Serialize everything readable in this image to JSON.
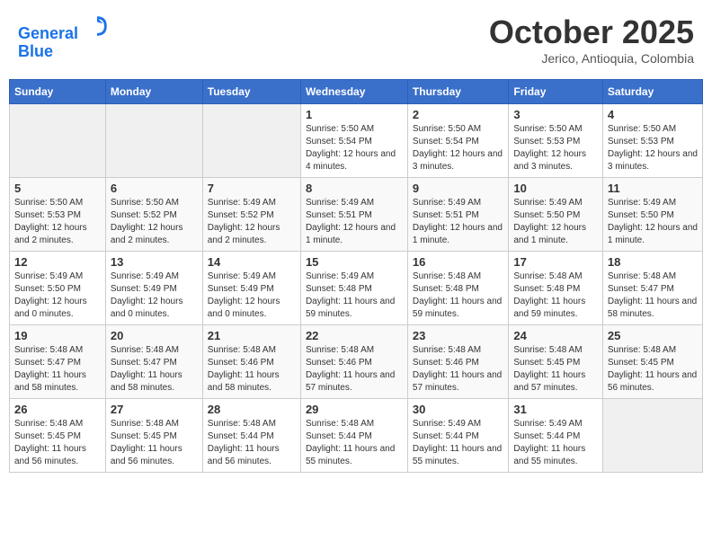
{
  "header": {
    "logo_line1": "General",
    "logo_line2": "Blue",
    "month_title": "October 2025",
    "subtitle": "Jerico, Antioquia, Colombia"
  },
  "weekdays": [
    "Sunday",
    "Monday",
    "Tuesday",
    "Wednesday",
    "Thursday",
    "Friday",
    "Saturday"
  ],
  "weeks": [
    [
      {
        "day": "",
        "empty": true
      },
      {
        "day": "",
        "empty": true
      },
      {
        "day": "",
        "empty": true
      },
      {
        "day": "1",
        "sunrise": "5:50 AM",
        "sunset": "5:54 PM",
        "daylight": "12 hours and 4 minutes."
      },
      {
        "day": "2",
        "sunrise": "5:50 AM",
        "sunset": "5:54 PM",
        "daylight": "12 hours and 3 minutes."
      },
      {
        "day": "3",
        "sunrise": "5:50 AM",
        "sunset": "5:53 PM",
        "daylight": "12 hours and 3 minutes."
      },
      {
        "day": "4",
        "sunrise": "5:50 AM",
        "sunset": "5:53 PM",
        "daylight": "12 hours and 3 minutes."
      }
    ],
    [
      {
        "day": "5",
        "sunrise": "5:50 AM",
        "sunset": "5:53 PM",
        "daylight": "12 hours and 2 minutes."
      },
      {
        "day": "6",
        "sunrise": "5:50 AM",
        "sunset": "5:52 PM",
        "daylight": "12 hours and 2 minutes."
      },
      {
        "day": "7",
        "sunrise": "5:49 AM",
        "sunset": "5:52 PM",
        "daylight": "12 hours and 2 minutes."
      },
      {
        "day": "8",
        "sunrise": "5:49 AM",
        "sunset": "5:51 PM",
        "daylight": "12 hours and 1 minute."
      },
      {
        "day": "9",
        "sunrise": "5:49 AM",
        "sunset": "5:51 PM",
        "daylight": "12 hours and 1 minute."
      },
      {
        "day": "10",
        "sunrise": "5:49 AM",
        "sunset": "5:50 PM",
        "daylight": "12 hours and 1 minute."
      },
      {
        "day": "11",
        "sunrise": "5:49 AM",
        "sunset": "5:50 PM",
        "daylight": "12 hours and 1 minute."
      }
    ],
    [
      {
        "day": "12",
        "sunrise": "5:49 AM",
        "sunset": "5:50 PM",
        "daylight": "12 hours and 0 minutes."
      },
      {
        "day": "13",
        "sunrise": "5:49 AM",
        "sunset": "5:49 PM",
        "daylight": "12 hours and 0 minutes."
      },
      {
        "day": "14",
        "sunrise": "5:49 AM",
        "sunset": "5:49 PM",
        "daylight": "12 hours and 0 minutes."
      },
      {
        "day": "15",
        "sunrise": "5:49 AM",
        "sunset": "5:48 PM",
        "daylight": "11 hours and 59 minutes."
      },
      {
        "day": "16",
        "sunrise": "5:48 AM",
        "sunset": "5:48 PM",
        "daylight": "11 hours and 59 minutes."
      },
      {
        "day": "17",
        "sunrise": "5:48 AM",
        "sunset": "5:48 PM",
        "daylight": "11 hours and 59 minutes."
      },
      {
        "day": "18",
        "sunrise": "5:48 AM",
        "sunset": "5:47 PM",
        "daylight": "11 hours and 58 minutes."
      }
    ],
    [
      {
        "day": "19",
        "sunrise": "5:48 AM",
        "sunset": "5:47 PM",
        "daylight": "11 hours and 58 minutes."
      },
      {
        "day": "20",
        "sunrise": "5:48 AM",
        "sunset": "5:47 PM",
        "daylight": "11 hours and 58 minutes."
      },
      {
        "day": "21",
        "sunrise": "5:48 AM",
        "sunset": "5:46 PM",
        "daylight": "11 hours and 58 minutes."
      },
      {
        "day": "22",
        "sunrise": "5:48 AM",
        "sunset": "5:46 PM",
        "daylight": "11 hours and 57 minutes."
      },
      {
        "day": "23",
        "sunrise": "5:48 AM",
        "sunset": "5:46 PM",
        "daylight": "11 hours and 57 minutes."
      },
      {
        "day": "24",
        "sunrise": "5:48 AM",
        "sunset": "5:45 PM",
        "daylight": "11 hours and 57 minutes."
      },
      {
        "day": "25",
        "sunrise": "5:48 AM",
        "sunset": "5:45 PM",
        "daylight": "11 hours and 56 minutes."
      }
    ],
    [
      {
        "day": "26",
        "sunrise": "5:48 AM",
        "sunset": "5:45 PM",
        "daylight": "11 hours and 56 minutes."
      },
      {
        "day": "27",
        "sunrise": "5:48 AM",
        "sunset": "5:45 PM",
        "daylight": "11 hours and 56 minutes."
      },
      {
        "day": "28",
        "sunrise": "5:48 AM",
        "sunset": "5:44 PM",
        "daylight": "11 hours and 56 minutes."
      },
      {
        "day": "29",
        "sunrise": "5:48 AM",
        "sunset": "5:44 PM",
        "daylight": "11 hours and 55 minutes."
      },
      {
        "day": "30",
        "sunrise": "5:49 AM",
        "sunset": "5:44 PM",
        "daylight": "11 hours and 55 minutes."
      },
      {
        "day": "31",
        "sunrise": "5:49 AM",
        "sunset": "5:44 PM",
        "daylight": "11 hours and 55 minutes."
      },
      {
        "day": "",
        "empty": true
      }
    ]
  ]
}
